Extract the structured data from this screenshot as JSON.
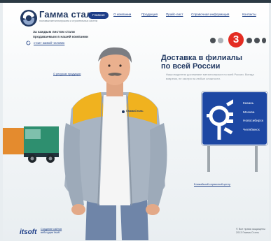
{
  "header": {
    "brand": "Гамма сталь",
    "tagline": "поставки металлопроката и строительных систем"
  },
  "nav": {
    "items": [
      {
        "label": "Главная"
      },
      {
        "label": "О компании"
      },
      {
        "label": "Продукция"
      },
      {
        "label": "Прайс-лист"
      },
      {
        "label": "Справочная информация"
      },
      {
        "label": "Контакты"
      }
    ]
  },
  "promo": {
    "line1": "За каждым листом стали",
    "line2": "продаваемым в нашей компании",
    "link": "стоит живой человек"
  },
  "side_links": {
    "left": "О ресурсах продукции",
    "right": "Ближайший сервисный центр"
  },
  "slider": {
    "current": "3",
    "headline_line1": "Доставка в филиалы",
    "headline_line2": "по всей России",
    "text": "Наши водители доставляют металлопрокат по всей России. Всегда вовремя, не смотря на любые сложности."
  },
  "badge": {
    "text": "ГаммаСталь"
  },
  "sign": {
    "cities": [
      "Казань",
      "Москва",
      "Новосибирск",
      "Челябинск"
    ]
  },
  "footer": {
    "logo": "itsoft",
    "link_line1": "Создание сайтов",
    "link_line2": "вебстудия itsoft",
    "copyright_line1": "© Все права защищены",
    "copyright_line2": "2013 Гамма-Сталь"
  },
  "colors": {
    "accent": "#233a63",
    "slide_badge": "#e42c22",
    "sign_blue": "#1d47a3"
  }
}
